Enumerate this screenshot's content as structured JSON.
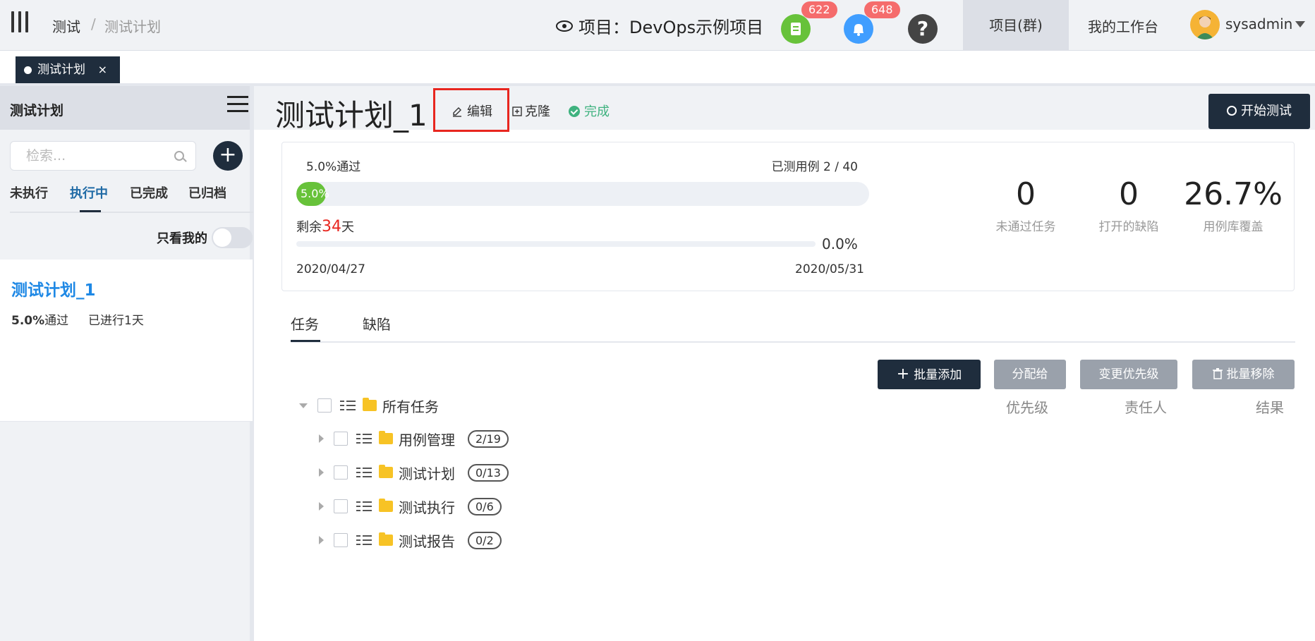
{
  "header": {
    "breadcrumb": [
      "测试",
      "测试计划"
    ],
    "breadcrumb_sep": "/",
    "project_label": "项目：DevOps示例项目",
    "doc_badge": "622",
    "bell_badge": "648",
    "help_icon": "?",
    "nav_projects": "项目(群)",
    "nav_workspace": "我的工作台",
    "username": "sysadmin"
  },
  "page_tab": {
    "label": "测试计划",
    "close": "×"
  },
  "sidebar": {
    "title": "测试计划",
    "search_placeholder": "检索...",
    "add_label": "+",
    "tabs": [
      "未执行",
      "执行中",
      "已完成",
      "已归档"
    ],
    "active_tab": "执行中",
    "only_mine": "只看我的",
    "plan": {
      "name": "测试计划_1",
      "pass_pct": "5.0%",
      "pass_suffix": "通过",
      "elapsed": "已进行1天"
    }
  },
  "main": {
    "title": "测试计划_1",
    "edit": "编辑",
    "clone": "克隆",
    "done": "完成",
    "start": "开始测试"
  },
  "stats": {
    "pass_label": "5.0%通过",
    "tested_label": "已测用例 2 / 40",
    "pass_progress": 5.0,
    "pass_bar_text": "5.0%",
    "remain_prefix": "剩余",
    "remain_days": "34",
    "remain_suffix": "天",
    "time_progress": 0.0,
    "time_pct": "0.0%",
    "start_date": "2020/04/27",
    "end_date": "2020/05/31",
    "metrics": [
      {
        "value": "0",
        "label": "未通过任务"
      },
      {
        "value": "0",
        "label": "打开的缺陷"
      },
      {
        "value": "26.7%",
        "label": "用例库覆盖"
      }
    ]
  },
  "tabs": {
    "tasks": "任务",
    "defects": "缺陷"
  },
  "actions": {
    "batch_add": "批量添加",
    "assign": "分配给",
    "priority": "变更优先级",
    "batch_remove": "批量移除"
  },
  "columns": {
    "priority": "优先级",
    "owner": "责任人",
    "result": "结果"
  },
  "tree": {
    "root": "所有任务",
    "children": [
      {
        "label": "用例管理",
        "count": "2/19"
      },
      {
        "label": "测试计划",
        "count": "0/13"
      },
      {
        "label": "测试执行",
        "count": "0/6"
      },
      {
        "label": "测试报告",
        "count": "0/2"
      }
    ]
  },
  "colors": {
    "accent": "#1f2d3d",
    "success": "#67c23a",
    "danger": "#e8261f",
    "link": "#1e88e5"
  }
}
